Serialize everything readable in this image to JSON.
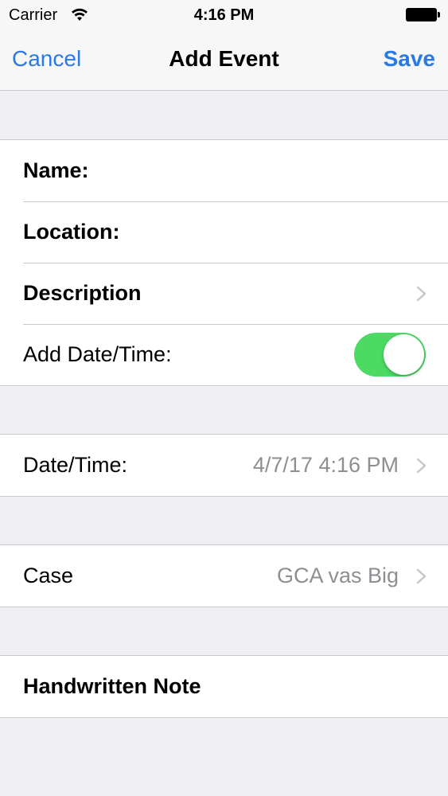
{
  "status_bar": {
    "carrier": "Carrier",
    "time": "4:16 PM",
    "wifi_icon": "wifi-icon",
    "battery_icon": "battery-icon"
  },
  "nav": {
    "cancel_label": "Cancel",
    "title": "Add Event",
    "save_label": "Save"
  },
  "details": {
    "name_label": "Name:",
    "location_label": "Location:",
    "description_label": "Description",
    "add_datetime_label": "Add Date/Time:",
    "add_datetime_enabled": true
  },
  "datetime": {
    "label": "Date/Time:",
    "value": "4/7/17 4:16 PM"
  },
  "case": {
    "label": "Case",
    "value": "GCA vas Big"
  },
  "note": {
    "label": "Handwritten Note"
  },
  "colors": {
    "accent": "#2a7ae2",
    "toggle_on": "#4cd964",
    "secondary_text": "#8e8e93",
    "background": "#efeff4"
  }
}
